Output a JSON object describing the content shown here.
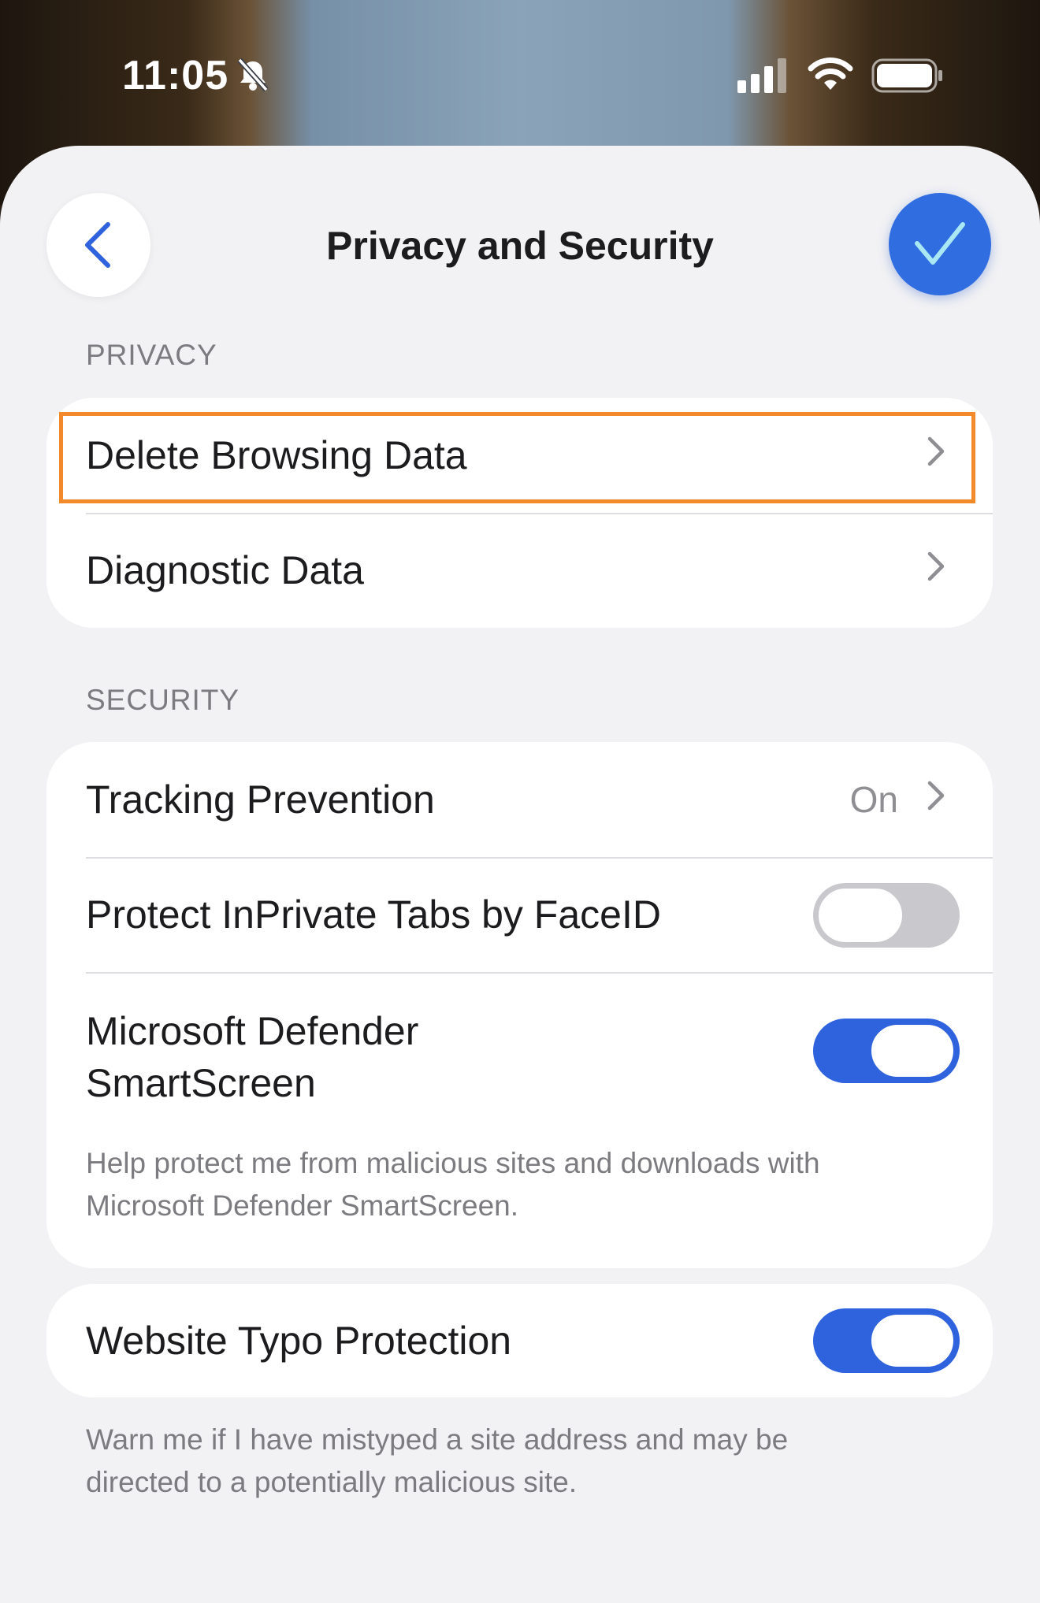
{
  "status_bar": {
    "time": "11:05",
    "icons": [
      "bell-slash-icon",
      "cellular-signal-icon",
      "wifi-icon",
      "battery-icon"
    ]
  },
  "header": {
    "title": "Privacy and Security",
    "back_icon": "chevron-left-icon",
    "done_icon": "checkmark-icon"
  },
  "privacy": {
    "header": "PRIVACY",
    "items": [
      {
        "label": "Delete Browsing Data"
      },
      {
        "label": "Diagnostic Data"
      }
    ]
  },
  "security": {
    "header": "SECURITY",
    "tracking_prevention": {
      "label": "Tracking Prevention",
      "value": "On"
    },
    "protect_inprivate": {
      "label": "Protect InPrivate Tabs by FaceID",
      "enabled": false
    },
    "smartscreen": {
      "label_line1": "Microsoft Defender",
      "label_line2": "SmartScreen",
      "enabled": true
    },
    "smartscreen_footnote_line1": "Help protect me from malicious sites and downloads with",
    "smartscreen_footnote_line2": "Microsoft Defender SmartScreen."
  },
  "typo": {
    "label": "Website Typo Protection",
    "enabled": true,
    "footnote_line1": "Warn me if I have mistyped a site address and may be",
    "footnote_line2": "directed to a potentially malicious site."
  },
  "colors": {
    "accent": "#2f62dd",
    "highlight": "#f28a2c",
    "background": "#f2f2f4"
  }
}
